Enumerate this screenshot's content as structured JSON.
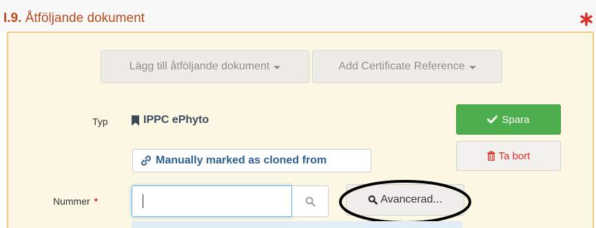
{
  "section": {
    "number": "I.9.",
    "title": "Åtföljande dokument",
    "required_marker": "asterisk-icon"
  },
  "toolbar": {
    "add_document_label": "Lägg till åtföljande dokument",
    "add_certificate_label": "Add Certificate Reference"
  },
  "document": {
    "type_label": "Typ",
    "type_value": "IPPC ePhyto",
    "type_icon": "bookmark-icon",
    "cloned_label": "Manually marked as cloned from",
    "cloned_icon": "link-icon"
  },
  "actions": {
    "save_label": "Spara",
    "save_icon": "check-icon",
    "delete_label": "Ta bort",
    "delete_icon": "trash-icon"
  },
  "number_field": {
    "label": "Nummer",
    "required_mark": "*",
    "value": "",
    "search_icon": "search-icon",
    "advanced_label": "Avancerad..."
  },
  "colors": {
    "title": "#b94a1f",
    "required": "#d9302a",
    "panel_bg": "#fcf8e3",
    "panel_border": "#f2c98a",
    "save": "#4cae4c",
    "link_text": "#2f5f8f"
  }
}
